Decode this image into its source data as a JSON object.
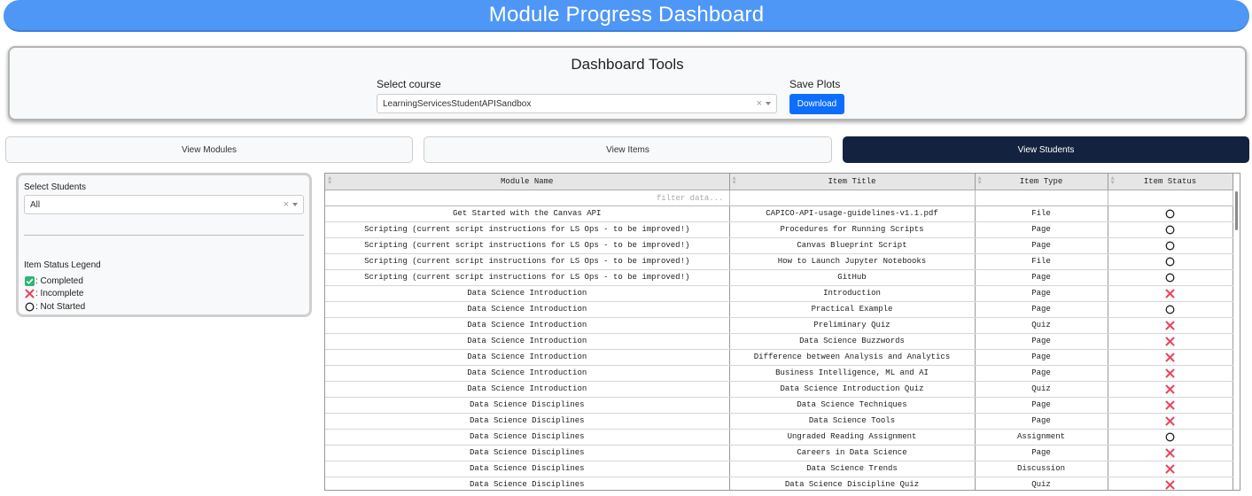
{
  "header": {
    "title": "Module Progress Dashboard"
  },
  "tools": {
    "title": "Dashboard Tools",
    "course_label": "Select course",
    "course_value": "LearningServicesStudentAPISandbox",
    "save_label": "Save Plots",
    "download_label": "Download"
  },
  "tabs": [
    {
      "label": "View Modules",
      "active": false
    },
    {
      "label": "View Items",
      "active": false
    },
    {
      "label": "View Students",
      "active": true
    }
  ],
  "sidebar": {
    "students_label": "Select Students",
    "students_value": "All",
    "legend_title": "Item Status Legend",
    "legend": [
      {
        "label": ": Completed",
        "icon": "completed-check-icon"
      },
      {
        "label": ": Incomplete",
        "icon": "incomplete-x-icon"
      },
      {
        "label": ": Not Started",
        "icon": "not-started-circle-icon"
      }
    ]
  },
  "colors": {
    "accent": "#4e97f7",
    "active_tab": "#13233f",
    "button": "#0d6efd",
    "completed": "#2bb673",
    "incomplete": "#e8445a",
    "not_started": "#222222"
  },
  "table": {
    "columns": [
      "Module Name",
      "Item Title",
      "Item Type",
      "Item Status"
    ],
    "filter_placeholder": "filter data...",
    "rows": [
      {
        "module": "Get Started with the Canvas API",
        "title": "CAPICO-API-usage-guidelines-v1.1.pdf",
        "type": "File",
        "status": "not-started"
      },
      {
        "module": "Scripting (current script instructions for LS Ops - to be improved!)",
        "title": "Procedures for Running Scripts",
        "type": "Page",
        "status": "not-started"
      },
      {
        "module": "Scripting (current script instructions for LS Ops - to be improved!)",
        "title": "Canvas Blueprint Script",
        "type": "Page",
        "status": "not-started"
      },
      {
        "module": "Scripting (current script instructions for LS Ops - to be improved!)",
        "title": "How to Launch Jupyter Notebooks",
        "type": "File",
        "status": "not-started"
      },
      {
        "module": "Scripting (current script instructions for LS Ops - to be improved!)",
        "title": "GitHub",
        "type": "Page",
        "status": "not-started"
      },
      {
        "module": "Data Science Introduction",
        "title": "Introduction",
        "type": "Page",
        "status": "incomplete"
      },
      {
        "module": "Data Science Introduction",
        "title": "Practical Example",
        "type": "Page",
        "status": "not-started"
      },
      {
        "module": "Data Science Introduction",
        "title": "Preliminary Quiz",
        "type": "Quiz",
        "status": "incomplete"
      },
      {
        "module": "Data Science Introduction",
        "title": "Data Science Buzzwords",
        "type": "Page",
        "status": "incomplete"
      },
      {
        "module": "Data Science Introduction",
        "title": "Difference between Analysis and Analytics",
        "type": "Page",
        "status": "incomplete"
      },
      {
        "module": "Data Science Introduction",
        "title": "Business Intelligence, ML and AI",
        "type": "Page",
        "status": "incomplete"
      },
      {
        "module": "Data Science Introduction",
        "title": "Data Science Introduction Quiz",
        "type": "Quiz",
        "status": "incomplete"
      },
      {
        "module": "Data Science Disciplines",
        "title": "Data Science Techniques",
        "type": "Page",
        "status": "incomplete"
      },
      {
        "module": "Data Science Disciplines",
        "title": "Data Science Tools",
        "type": "Page",
        "status": "incomplete"
      },
      {
        "module": "Data Science Disciplines",
        "title": "Ungraded Reading Assignment",
        "type": "Assignment",
        "status": "not-started"
      },
      {
        "module": "Data Science Disciplines",
        "title": "Careers in Data Science",
        "type": "Page",
        "status": "incomplete"
      },
      {
        "module": "Data Science Disciplines",
        "title": "Data Science Trends",
        "type": "Discussion",
        "status": "incomplete"
      },
      {
        "module": "Data Science Disciplines",
        "title": "Data Science Discipline Quiz",
        "type": "Quiz",
        "status": "incomplete"
      }
    ]
  }
}
